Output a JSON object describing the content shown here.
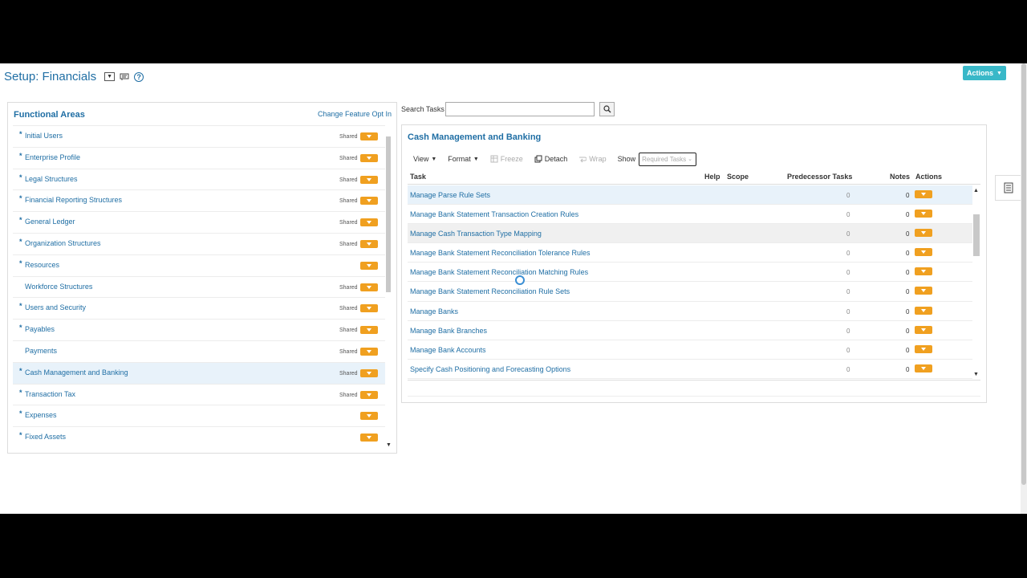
{
  "header": {
    "title": "Setup: Financials",
    "actions_label": "Actions"
  },
  "functional_areas": {
    "title": "Functional Areas",
    "link": "Change Feature Opt In",
    "items": [
      {
        "label": "Initial Users",
        "required": true,
        "shared": "Shared",
        "selected": false
      },
      {
        "label": "Enterprise Profile",
        "required": true,
        "shared": "Shared",
        "selected": false
      },
      {
        "label": "Legal Structures",
        "required": true,
        "shared": "Shared",
        "selected": false
      },
      {
        "label": "Financial Reporting Structures",
        "required": true,
        "shared": "Shared",
        "selected": false
      },
      {
        "label": "General Ledger",
        "required": true,
        "shared": "Shared",
        "selected": false
      },
      {
        "label": "Organization Structures",
        "required": true,
        "shared": "Shared",
        "selected": false
      },
      {
        "label": "Resources",
        "required": true,
        "shared": "",
        "selected": false
      },
      {
        "label": "Workforce Structures",
        "required": false,
        "shared": "Shared",
        "selected": false
      },
      {
        "label": "Users and Security",
        "required": true,
        "shared": "Shared",
        "selected": false
      },
      {
        "label": "Payables",
        "required": true,
        "shared": "Shared",
        "selected": false
      },
      {
        "label": "Payments",
        "required": false,
        "shared": "Shared",
        "selected": false
      },
      {
        "label": "Cash Management and Banking",
        "required": true,
        "shared": "Shared",
        "selected": true
      },
      {
        "label": "Transaction Tax",
        "required": true,
        "shared": "Shared",
        "selected": false
      },
      {
        "label": "Expenses",
        "required": true,
        "shared": "",
        "selected": false
      },
      {
        "label": "Fixed Assets",
        "required": true,
        "shared": "",
        "selected": false
      }
    ]
  },
  "search": {
    "label": "Search Tasks",
    "value": ""
  },
  "tasks_panel": {
    "title": "Cash Management and Banking",
    "toolbar": {
      "view": "View",
      "format": "Format",
      "freeze": "Freeze",
      "detach": "Detach",
      "wrap": "Wrap",
      "show": "Show",
      "show_value": "Required Tasks"
    },
    "columns": {
      "task": "Task",
      "help": "Help",
      "scope": "Scope",
      "predecessor": "Predecessor Tasks",
      "notes": "Notes",
      "actions": "Actions"
    },
    "rows": [
      {
        "task": "Manage Parse Rule Sets",
        "pred": "0",
        "notes": "0",
        "state": "selected"
      },
      {
        "task": "Manage Bank Statement Transaction Creation Rules",
        "pred": "0",
        "notes": "0",
        "state": ""
      },
      {
        "task": "Manage Cash Transaction Type Mapping",
        "pred": "0",
        "notes": "0",
        "state": "hover"
      },
      {
        "task": "Manage Bank Statement Reconciliation Tolerance Rules",
        "pred": "0",
        "notes": "0",
        "state": ""
      },
      {
        "task": "Manage Bank Statement Reconciliation Matching Rules",
        "pred": "0",
        "notes": "0",
        "state": ""
      },
      {
        "task": "Manage Bank Statement Reconciliation Rule Sets",
        "pred": "0",
        "notes": "0",
        "state": ""
      },
      {
        "task": "Manage Banks",
        "pred": "0",
        "notes": "0",
        "state": ""
      },
      {
        "task": "Manage Bank Branches",
        "pred": "0",
        "notes": "0",
        "state": ""
      },
      {
        "task": "Manage Bank Accounts",
        "pred": "0",
        "notes": "0",
        "state": ""
      },
      {
        "task": "Specify Cash Positioning and Forecasting Options",
        "pred": "0",
        "notes": "0",
        "state": ""
      }
    ]
  },
  "colors": {
    "link": "#1f6ea4",
    "accent": "#39b8c8",
    "action_button": "#f0a020",
    "selected_row": "#e8f2fa"
  }
}
